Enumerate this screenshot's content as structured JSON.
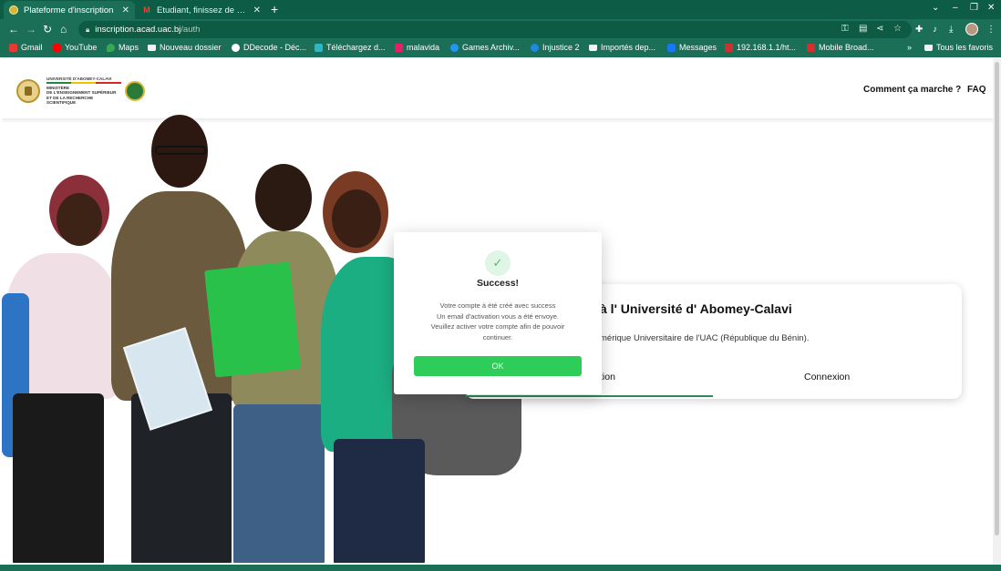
{
  "browser": {
    "tabs": [
      {
        "title": "Plateforme d'inscription",
        "active": true,
        "favicon": "uac-seal-icon"
      },
      {
        "title": "Etudiant, finissez de con...",
        "active": false,
        "favicon": "gmail-icon"
      }
    ],
    "new_tab_glyph": "+",
    "window_controls": [
      "⌄",
      "–",
      "❐",
      "✕"
    ],
    "url": {
      "host": "inscription.acad.uac.bj",
      "path": "/auth"
    },
    "bookmarks": [
      {
        "label": "Gmail",
        "icon": "gmail-icon"
      },
      {
        "label": "YouTube",
        "icon": "youtube-icon"
      },
      {
        "label": "Maps",
        "icon": "maps-icon"
      },
      {
        "label": "Nouveau dossier",
        "icon": "folder-icon"
      },
      {
        "label": "DDecode - Déc...",
        "icon": "ddecode-icon"
      },
      {
        "label": "Téléchargez d...",
        "icon": "download-site-icon"
      },
      {
        "label": "malavida",
        "icon": "malavida-icon"
      },
      {
        "label": "Games Archiv...",
        "icon": "games-archive-icon"
      },
      {
        "label": "Injustice 2",
        "icon": "injustice-icon"
      },
      {
        "label": "Importés dep...",
        "icon": "folder-icon"
      },
      {
        "label": "Messages",
        "icon": "facebook-icon"
      },
      {
        "label": "192.168.1.1/ht...",
        "icon": "huawei-icon"
      },
      {
        "label": "Mobile Broad...",
        "icon": "huawei-icon"
      }
    ],
    "bookmarks_overflow": "»",
    "all_bookmarks_label": "Tous les favoris"
  },
  "header": {
    "logo_lines": [
      "Université d'Abomey-Calavi",
      "Ministère",
      "de l'enseignement supérieur",
      "et de la recherche scientifique"
    ],
    "nav": [
      "Comment ça marche ?",
      "FAQ"
    ]
  },
  "registration": {
    "title_visible": "à l' Université d' Abomey-Calavi",
    "subtitle_visible": "mérique Universitaire de l'UAC (République du Bénin).",
    "tab_inscription_visible": "tion",
    "tab_connexion": "Connexion"
  },
  "modal": {
    "icon": "checkmark-icon",
    "title": "Success!",
    "lines": [
      "Votre compte à été créé avec success",
      "Un email d'activation vous a été envoye.",
      "Veuillez activer votre compte afin de pouvoir",
      "continuer."
    ],
    "ok_label": "OK"
  },
  "colors": {
    "chrome_green": "#1b6f56",
    "tab_strip": "#0d5c45",
    "ok_button": "#2ecc58",
    "tab_underline": "#2e8b57"
  }
}
